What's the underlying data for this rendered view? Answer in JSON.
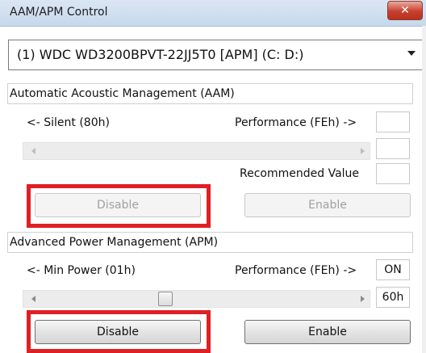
{
  "window": {
    "title": "AAM/APM Control",
    "close_symbol": "✕"
  },
  "drive": {
    "selected": "(1) WDC WD3200BPVT-22JJ5T0 [APM] (C: D:)"
  },
  "aam": {
    "header": "Automatic Acoustic Management (AAM)",
    "min_label": "<- Silent (80h)",
    "max_label": "Performance (FEh) ->",
    "status_value": "",
    "current_value": "",
    "recommended_label": "Recommended Value",
    "recommended_value": "",
    "disable_label": "Disable",
    "enable_label": "Enable"
  },
  "apm": {
    "header": "Advanced Power Management (APM)",
    "min_label": "<- Min Power (01h)",
    "max_label": "Performance (FEh) ->",
    "status_value": "ON",
    "current_value": "60h",
    "disable_label": "Disable",
    "enable_label": "Enable"
  },
  "colors": {
    "highlight": "#e01f24"
  }
}
